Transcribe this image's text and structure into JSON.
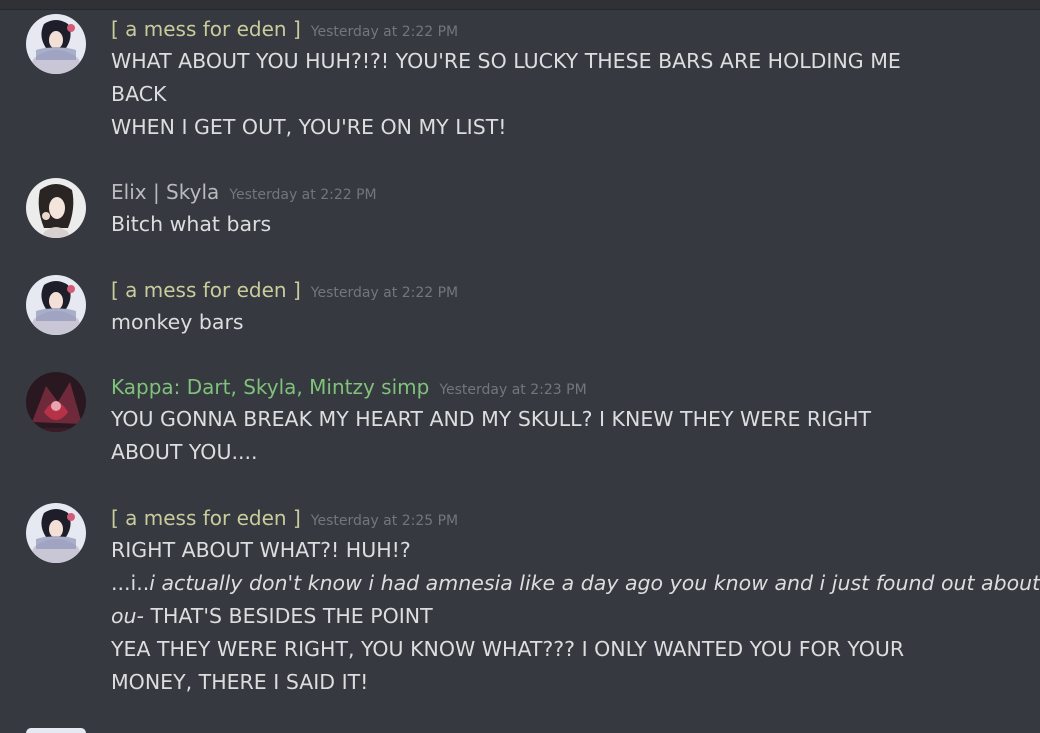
{
  "messages": [
    {
      "author": "[ a mess for eden ]",
      "author_color": "#c9cc9c",
      "timestamp": "Yesterday at 2:22 PM",
      "lines": [
        "WHAT ABOUT YOU HUH?!?! YOU'RE SO LUCKY THESE BARS ARE HOLDING ME",
        "BACK",
        "WHEN I GET OUT, YOU'RE ON MY LIST!"
      ]
    },
    {
      "author": "Elix | Skyla",
      "author_color": "#b9bbbe",
      "timestamp": "Yesterday at 2:22 PM",
      "lines": [
        "Bitch what bars"
      ]
    },
    {
      "author": "[ a mess for eden ]",
      "author_color": "#c9cc9c",
      "timestamp": "Yesterday at 2:22 PM",
      "lines": [
        "monkey bars"
      ]
    },
    {
      "author": "Kappa: Dart, Skyla, Mintzy simp",
      "author_color": "#7fc27a",
      "timestamp": "Yesterday at 2:23 PM",
      "lines": [
        "YOU GONNA BREAK MY HEART AND MY SKULL? I KNEW THEY WERE RIGHT",
        "ABOUT YOU...."
      ]
    },
    {
      "author": "[ a mess for eden ]",
      "author_color": "#c9cc9c",
      "timestamp": "Yesterday at 2:25 PM",
      "lines": [
        "RIGHT ABOUT WHAT?! HUH!?"
      ],
      "italic_prefix": "...i..",
      "italic_text_1": "i actually don't know i had amnesia like a day ago you know and i just found out about",
      "italic_text_2": "ou-",
      "after_italic": " THAT'S BESIDES THE POINT",
      "lines_after": [
        "YEA THEY WERE RIGHT, YOU KNOW WHAT??? I ONLY WANTED YOU FOR YOUR",
        "MONEY, THERE I SAID IT!"
      ]
    }
  ]
}
